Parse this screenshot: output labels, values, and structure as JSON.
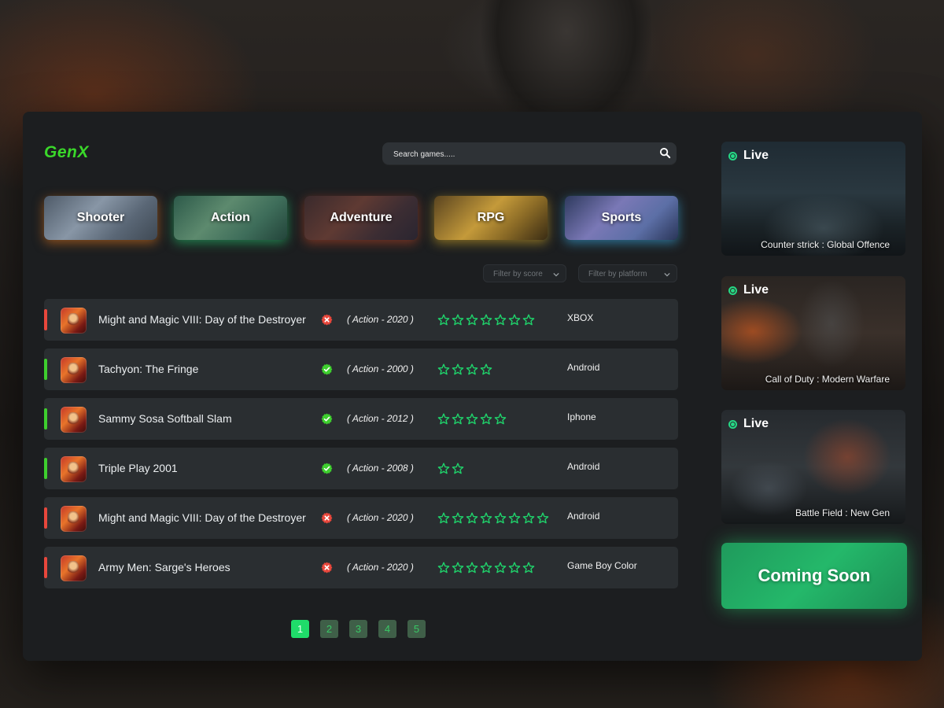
{
  "brand": {
    "logo": "GenX"
  },
  "search": {
    "placeholder": "Search games....."
  },
  "categories": [
    {
      "label": "Shooter"
    },
    {
      "label": "Action"
    },
    {
      "label": "Adventure"
    },
    {
      "label": "RPG"
    },
    {
      "label": "Sports"
    }
  ],
  "filters": {
    "score": "Filter by score",
    "platform": "Filter by platform"
  },
  "games": [
    {
      "title": "Might and Magic VIII: Day of the Destroyer",
      "status": "unavailable",
      "genre": "( Action - 2020 )",
      "stars": 7,
      "platform": "XBOX"
    },
    {
      "title": "Tachyon: The Fringe",
      "status": "available",
      "genre": "( Action - 2000 )",
      "stars": 4,
      "platform": "Android"
    },
    {
      "title": "Sammy Sosa Softball Slam",
      "status": "available",
      "genre": "( Action - 2012 )",
      "stars": 5,
      "platform": "Iphone"
    },
    {
      "title": "Triple Play 2001",
      "status": "available",
      "genre": "( Action - 2008 )",
      "stars": 2,
      "platform": "Android"
    },
    {
      "title": "Might and Magic VIII: Day of the Destroyer",
      "status": "unavailable",
      "genre": "( Action - 2020 )",
      "stars": 8,
      "platform": "Android"
    },
    {
      "title": "Army Men: Sarge's Heroes",
      "status": "unavailable",
      "genre": "( Action - 2020 )",
      "stars": 7,
      "platform": "Game Boy Color"
    }
  ],
  "pagination": {
    "pages": [
      "1",
      "2",
      "3",
      "4",
      "5"
    ],
    "current": "1"
  },
  "live": [
    {
      "badge": "Live",
      "caption": "Counter strick : Global Offence"
    },
    {
      "badge": "Live",
      "caption": "Call of Duty : Modern Warfare"
    },
    {
      "badge": "Live",
      "caption": "Battle Field : New Gen"
    }
  ],
  "coming_soon": {
    "label": "Coming Soon"
  },
  "colors": {
    "accent": "#1fdc6a",
    "logo": "#3ad82a",
    "star": "#1fd36b",
    "status_ok": "#3ecf2e",
    "status_bad": "#e8473c"
  },
  "icons": {
    "search": "search-icon",
    "chevron": "chevron-down-icon",
    "available": "check-badge-icon",
    "unavailable": "close-badge-icon",
    "star": "star-outline-icon",
    "live": "live-dot-icon"
  }
}
